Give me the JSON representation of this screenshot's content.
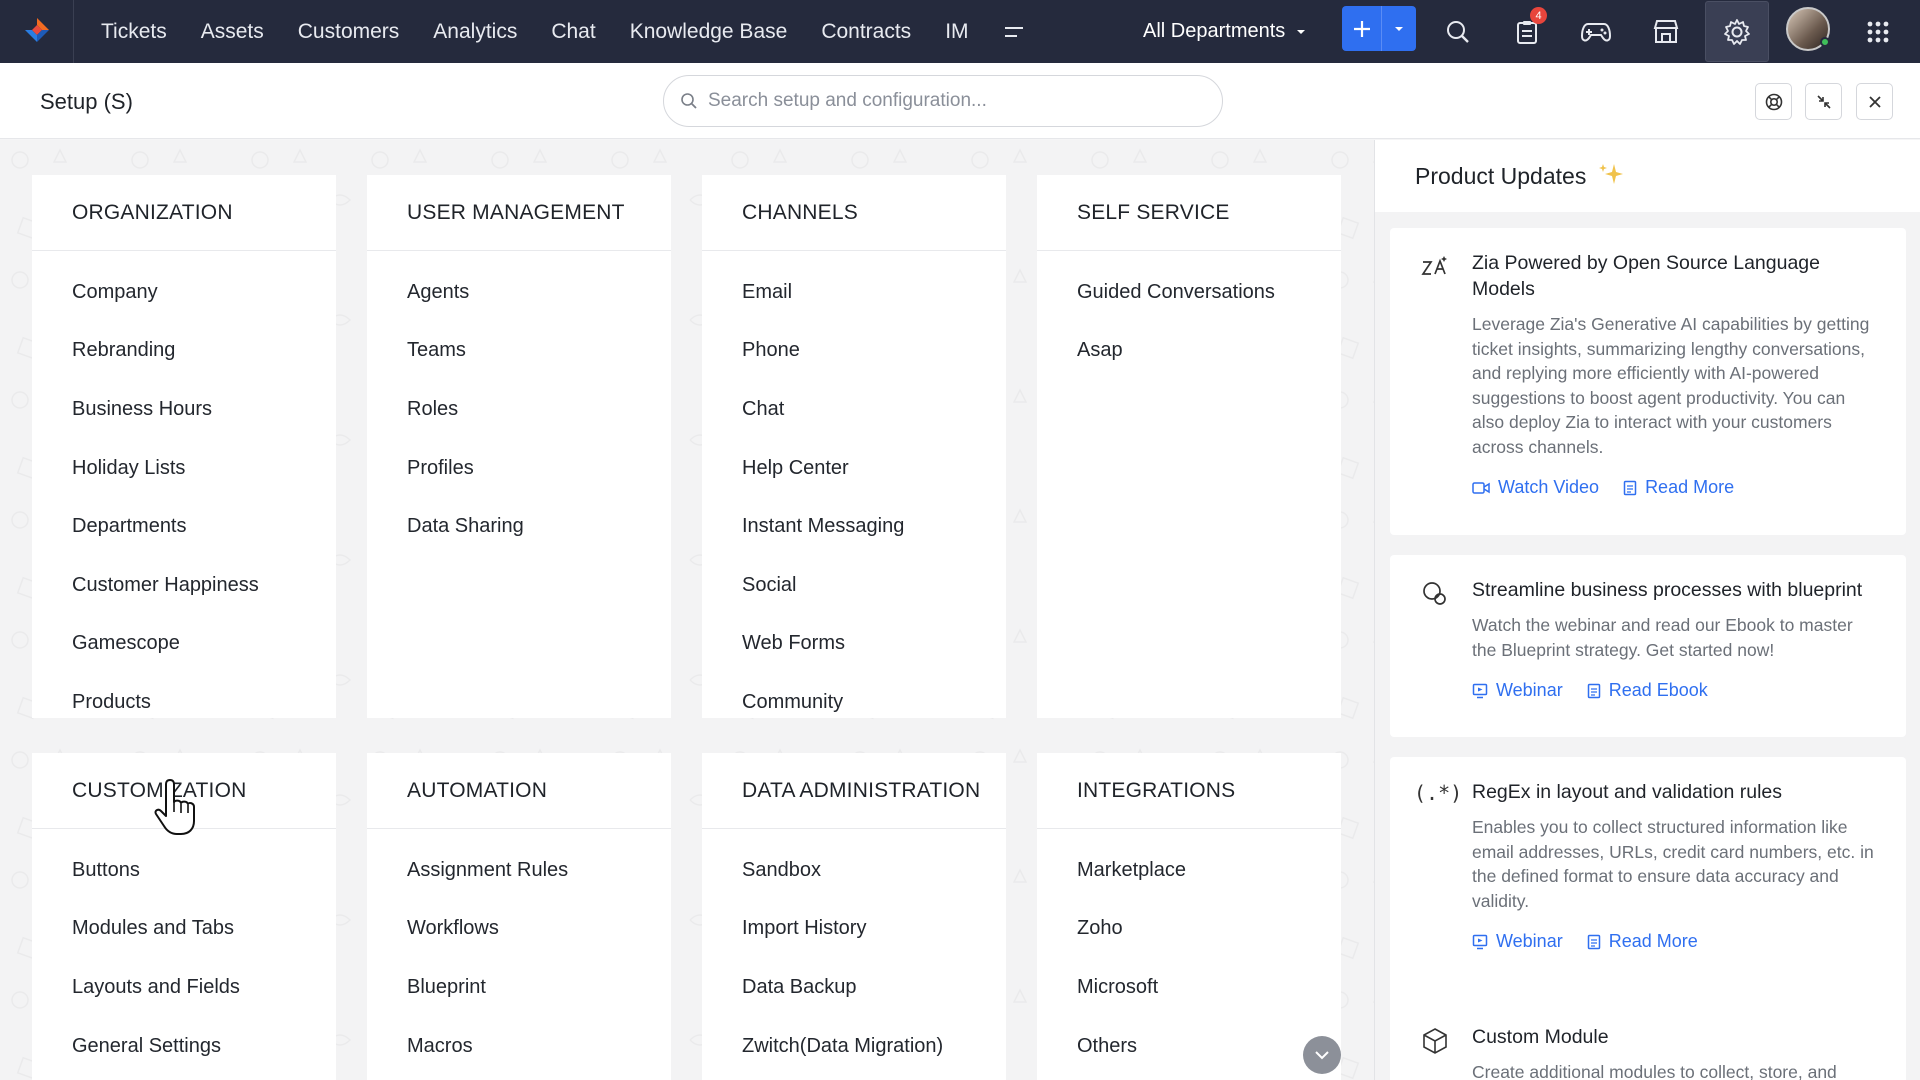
{
  "topnav": {
    "items": [
      "Tickets",
      "Assets",
      "Customers",
      "Analytics",
      "Chat",
      "Knowledge Base",
      "Contracts",
      "IM"
    ],
    "department": "All Departments",
    "notification_count": "4"
  },
  "setup": {
    "title": "Setup (S)",
    "search_placeholder": "Search setup and configuration..."
  },
  "sections": [
    {
      "title": "ORGANIZATION",
      "items": [
        "Company",
        "Rebranding",
        "Business Hours",
        "Holiday Lists",
        "Departments",
        "Customer Happiness",
        "Gamescope",
        "Products"
      ]
    },
    {
      "title": "USER MANAGEMENT",
      "items": [
        "Agents",
        "Teams",
        "Roles",
        "Profiles",
        "Data Sharing"
      ]
    },
    {
      "title": "CHANNELS",
      "items": [
        "Email",
        "Phone",
        "Chat",
        "Help Center",
        "Instant Messaging",
        "Social",
        "Web Forms",
        "Community"
      ]
    },
    {
      "title": "SELF SERVICE",
      "items": [
        "Guided Conversations",
        "Asap"
      ]
    },
    {
      "title": "CUSTOMIZATION",
      "items": [
        "Buttons",
        "Modules and Tabs",
        "Layouts and Fields",
        "General Settings"
      ]
    },
    {
      "title": "AUTOMATION",
      "items": [
        "Assignment Rules",
        "Workflows",
        "Blueprint",
        "Macros"
      ]
    },
    {
      "title": "DATA ADMINISTRATION",
      "items": [
        "Sandbox",
        "Import History",
        "Data Backup",
        "Zwitch(Data Migration)"
      ]
    },
    {
      "title": "INTEGRATIONS",
      "items": [
        "Marketplace",
        "Zoho",
        "Microsoft",
        "Others"
      ]
    }
  ],
  "updates": {
    "title": "Product Updates",
    "cards": [
      {
        "title": "Zia Powered by Open Source Language Models",
        "desc": "Leverage Zia's Generative AI capabilities by getting ticket insights, summarizing lengthy conversations, and replying more efficiently with AI-powered suggestions to boost agent productivity. You can also deploy Zia to interact with your customers across channels.",
        "link1": "Watch Video",
        "link2": "Read More"
      },
      {
        "title": "Streamline business processes with blueprint",
        "desc": "Watch the webinar and read our Ebook to master the Blueprint strategy. Get started now!",
        "link1": "Webinar",
        "link2": "Read Ebook"
      },
      {
        "title": "RegEx in layout and validation rules",
        "desc": "Enables you to collect structured information like email addresses, URLs, credit card numbers, etc. in the defined format to ensure data accuracy and validity.",
        "link1": "Webinar",
        "link2": "Read More"
      },
      {
        "title": "Custom Module",
        "desc": "Create additional modules to collect, store, and"
      }
    ]
  },
  "colors": {
    "nav_bg": "#252a3d",
    "accent": "#2f6ff0",
    "badge": "#e8453c"
  }
}
